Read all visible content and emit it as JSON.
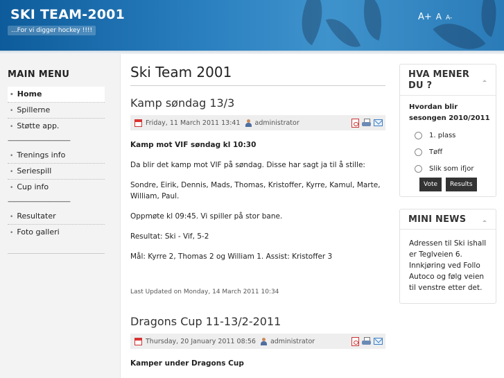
{
  "header": {
    "site_title": "SKI TEAM-2001",
    "slogan": "...For vi digger hockey !!!!",
    "font_controls": {
      "increase": "A+",
      "reset": "A",
      "decrease": "A-"
    }
  },
  "menu": {
    "title": "MAIN MENU",
    "items": [
      {
        "label": "Home",
        "active": true
      },
      {
        "label": "Spillerne"
      },
      {
        "label": "Støtte app."
      },
      {
        "separator": "----------------------------------------"
      },
      {
        "label": "Trenings info"
      },
      {
        "label": "Seriespill"
      },
      {
        "label": "Cup info"
      },
      {
        "separator": "----------------------------------------"
      },
      {
        "label": "Resultater"
      },
      {
        "label": "Foto galleri"
      }
    ]
  },
  "main": {
    "page_title": "Ski Team 2001",
    "articles": [
      {
        "title": "Kamp søndag 13/3",
        "date": "Friday, 11 March 2011 13:41",
        "author": "administrator",
        "paragraphs": [
          "Kamp mot VIF søndag kl 10:30",
          "Da blir det kamp mot VIF på søndag. Disse har sagt ja til å stille:",
          "Sondre, Eirik, Dennis, Mads, Thomas, Kristoffer, Kyrre, Kamul, Marte, William, Paul.",
          "Oppmøte kl 09:45. Vi spiller på stor bane.",
          "Resultat: Ski - Vif, 5-2",
          "Mål: Kyrre 2, Thomas 2 og William 1. Assist: Kristoffer 3"
        ],
        "last_updated": "Last Updated on Monday, 14 March 2011 10:34"
      },
      {
        "title": "Dragons Cup 11-13/2-2011",
        "date": "Thursday, 20 January 2011 08:56",
        "author": "administrator",
        "paragraphs": [
          "Kamper under Dragons Cup"
        ]
      }
    ]
  },
  "poll": {
    "title": "HVA MENER DU ?",
    "question": "Hvordan blir sesongen 2010/2011",
    "options": [
      "1. plass",
      "Tøff",
      "Slik som ifjor"
    ],
    "vote_label": "Vote",
    "results_label": "Results"
  },
  "mini_news": {
    "title": "MINI NEWS",
    "text": "Adressen til Ski ishall er Teglveien 6. Innkjøring ved Follo Autoco og følg veien til venstre etter det."
  },
  "colors": {
    "header_blue": "#2a7fbf",
    "button_dark": "#333333"
  }
}
